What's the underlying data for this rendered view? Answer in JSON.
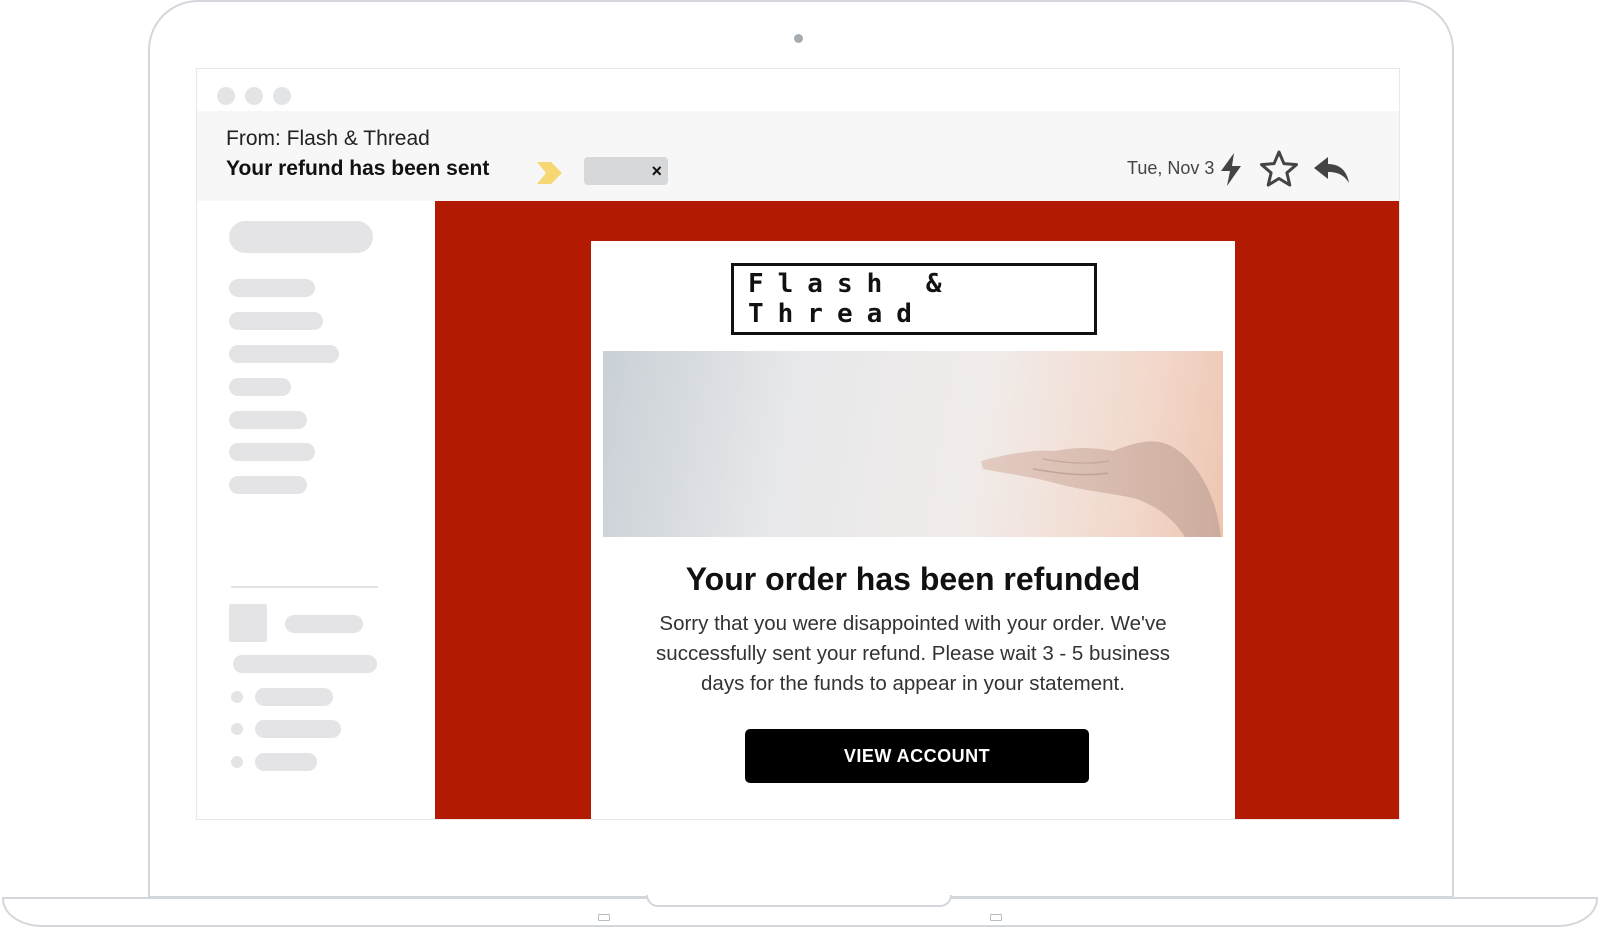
{
  "email": {
    "from": "From: Flash & Thread",
    "subject": "Your refund has been sent",
    "date": "Tue, Nov 3",
    "label_close": "×"
  },
  "icons": {
    "important": "important-marker-icon",
    "lightning": "lightning-icon",
    "star": "star-icon",
    "reply": "reply-icon"
  },
  "message": {
    "brand": "Flash & Thread",
    "headline": "Your order has been refunded",
    "body": "Sorry that you were disappointed with your order. We've successfully sent your refund. Please wait 3 - 5 business days for the funds to appear in your statement.",
    "cta_label": "VIEW ACCOUNT"
  },
  "colors": {
    "email_background": "#b31a02",
    "important_marker": "#f7d774",
    "cta_background": "#000000"
  }
}
